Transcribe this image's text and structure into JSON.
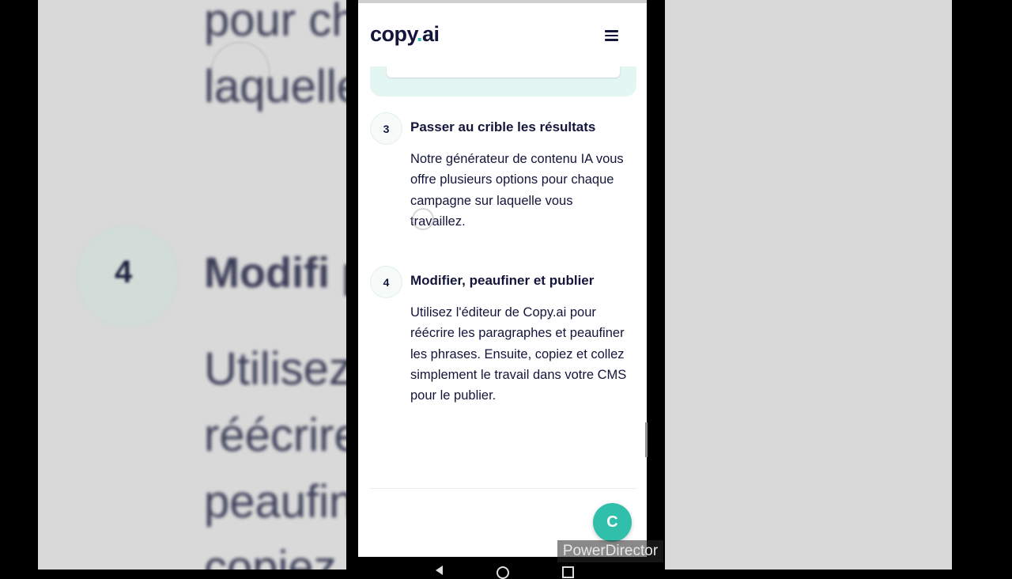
{
  "app": {
    "logo_main": "copy",
    "logo_dot": ".",
    "logo_suffix": "ai",
    "menu_icon": "hamburger-menu-icon"
  },
  "steps": [
    {
      "number": "3",
      "title": "Passer au crible les résultats",
      "body": "Notre générateur de contenu IA vous offre plusieurs options pour chaque campagne sur laquelle vous travaillez."
    },
    {
      "number": "4",
      "title": "Modifier, peaufiner et publier",
      "body": "Utilisez l'éditeur de Copy.ai pour réécrire les paragraphes et peaufiner les phrases. Ensuite, copiez et collez simplement le travail dans votre CMS pour le publier."
    }
  ],
  "fab": {
    "label": "C",
    "icon": "chat-icon"
  },
  "background_zoom": {
    "lines": [
      "pour ch                                  e sur",
      "laquelle                                     .",
      "Modifi                                  publier",
      "Utilisez                             py.ai pour",
      "réécrire                              es et",
      "peaufin                              Ensuite,",
      "copiez                              ment le"
    ],
    "step_number": "4"
  },
  "watermark": "PowerDirector",
  "colors": {
    "brand_teal": "#2fbfab",
    "text_navy": "#13163a",
    "card_mint": "#e4f6f2"
  }
}
